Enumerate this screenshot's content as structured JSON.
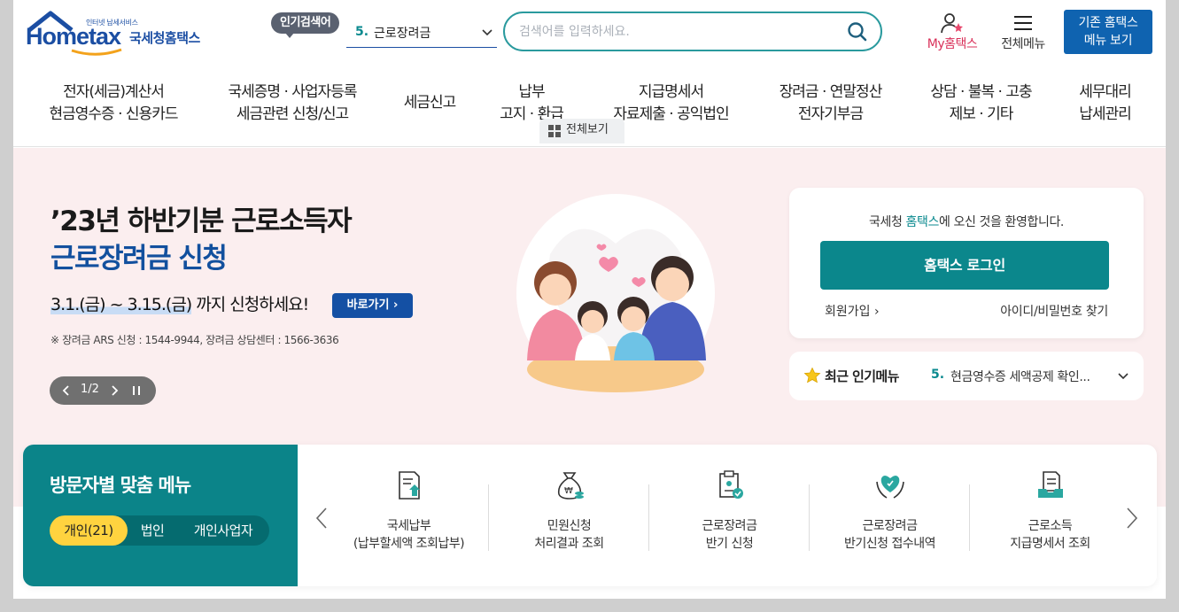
{
  "logo": {
    "small": "인터넷 납세서비스",
    "brand": "Hometax",
    "name": "국세청홈택스"
  },
  "header": {
    "popular_label": "인기검색어",
    "popular_rank": "5.",
    "popular_term": "근로장려금",
    "search_placeholder": "검색어를 입력하세요.",
    "my_hometax": "My홈택스",
    "all_menu": "전체메뉴",
    "old_button": [
      "기존 홈택스",
      "메뉴 보기"
    ]
  },
  "gnb": [
    {
      "line1": "전자(세금)계산서",
      "line2": "현금영수증 · 신용카드"
    },
    {
      "line1": "국세증명 · 사업자등록",
      "line2": "세금관련 신청/신고"
    },
    {
      "line1": "세금신고",
      "line2": ""
    },
    {
      "line1": "납부",
      "line2": "고지 · 환급"
    },
    {
      "line1": "지급명세서",
      "line2": "자료제출 · 공익법인"
    },
    {
      "line1": "장려금 · 연말정산",
      "line2": "전자기부금"
    },
    {
      "line1": "상담 · 불복 · 고충",
      "line2": "제보 · 기타"
    },
    {
      "line1": "세무대리",
      "line2": "납세관리"
    }
  ],
  "hero": {
    "title_line1": "’23년 하반기분 근로소득자",
    "title_line2": "근로장려금 신청",
    "period_dates": "3.1.(금) ~ 3.15.(금)",
    "period_suffix": " 까지 신청하세요!",
    "go_button": "바로가기",
    "note": "※ 장려금 ARS 신청 : 1544-9944, 장려금 상담센터 : 1566-3636",
    "pager": "1/2"
  },
  "login": {
    "welcome_prefix": "국세청 ",
    "welcome_highlight": "홈택스",
    "welcome_suffix": "에 오신 것을 환영합니다.",
    "login_button": "홈택스 로그인",
    "join": "회원가입",
    "find": "아이디/비밀번호 찾기"
  },
  "recent": {
    "title": "최근 인기메뉴",
    "rank": "5.",
    "item": "현금영수증 세액공제 확인..."
  },
  "visitor": {
    "title": "방문자별 맞춤 메뉴",
    "tabs": [
      "개인(21)",
      "법인",
      "개인사업자"
    ],
    "active_tab": 0,
    "menus": [
      {
        "l1": "국세납부",
        "l2": "(납부할세액 조회납부)",
        "icon": "tax-payment-icon"
      },
      {
        "l1": "민원신청",
        "l2": "처리결과 조회",
        "icon": "money-bag-icon"
      },
      {
        "l1": "근로장려금",
        "l2": "반기 신청",
        "icon": "clipboard-check-icon"
      },
      {
        "l1": "근로장려금",
        "l2": "반기신청 접수내역",
        "icon": "heart-hands-icon"
      },
      {
        "l1": "근로소득",
        "l2": "지급명세서 조회",
        "icon": "document-tray-icon"
      }
    ],
    "view_all": "전체보기"
  },
  "colors": {
    "teal": "#0b878c",
    "navy": "#1b4ea3",
    "pink_bg": "#fbeeef",
    "yellow": "#ffd33f"
  }
}
